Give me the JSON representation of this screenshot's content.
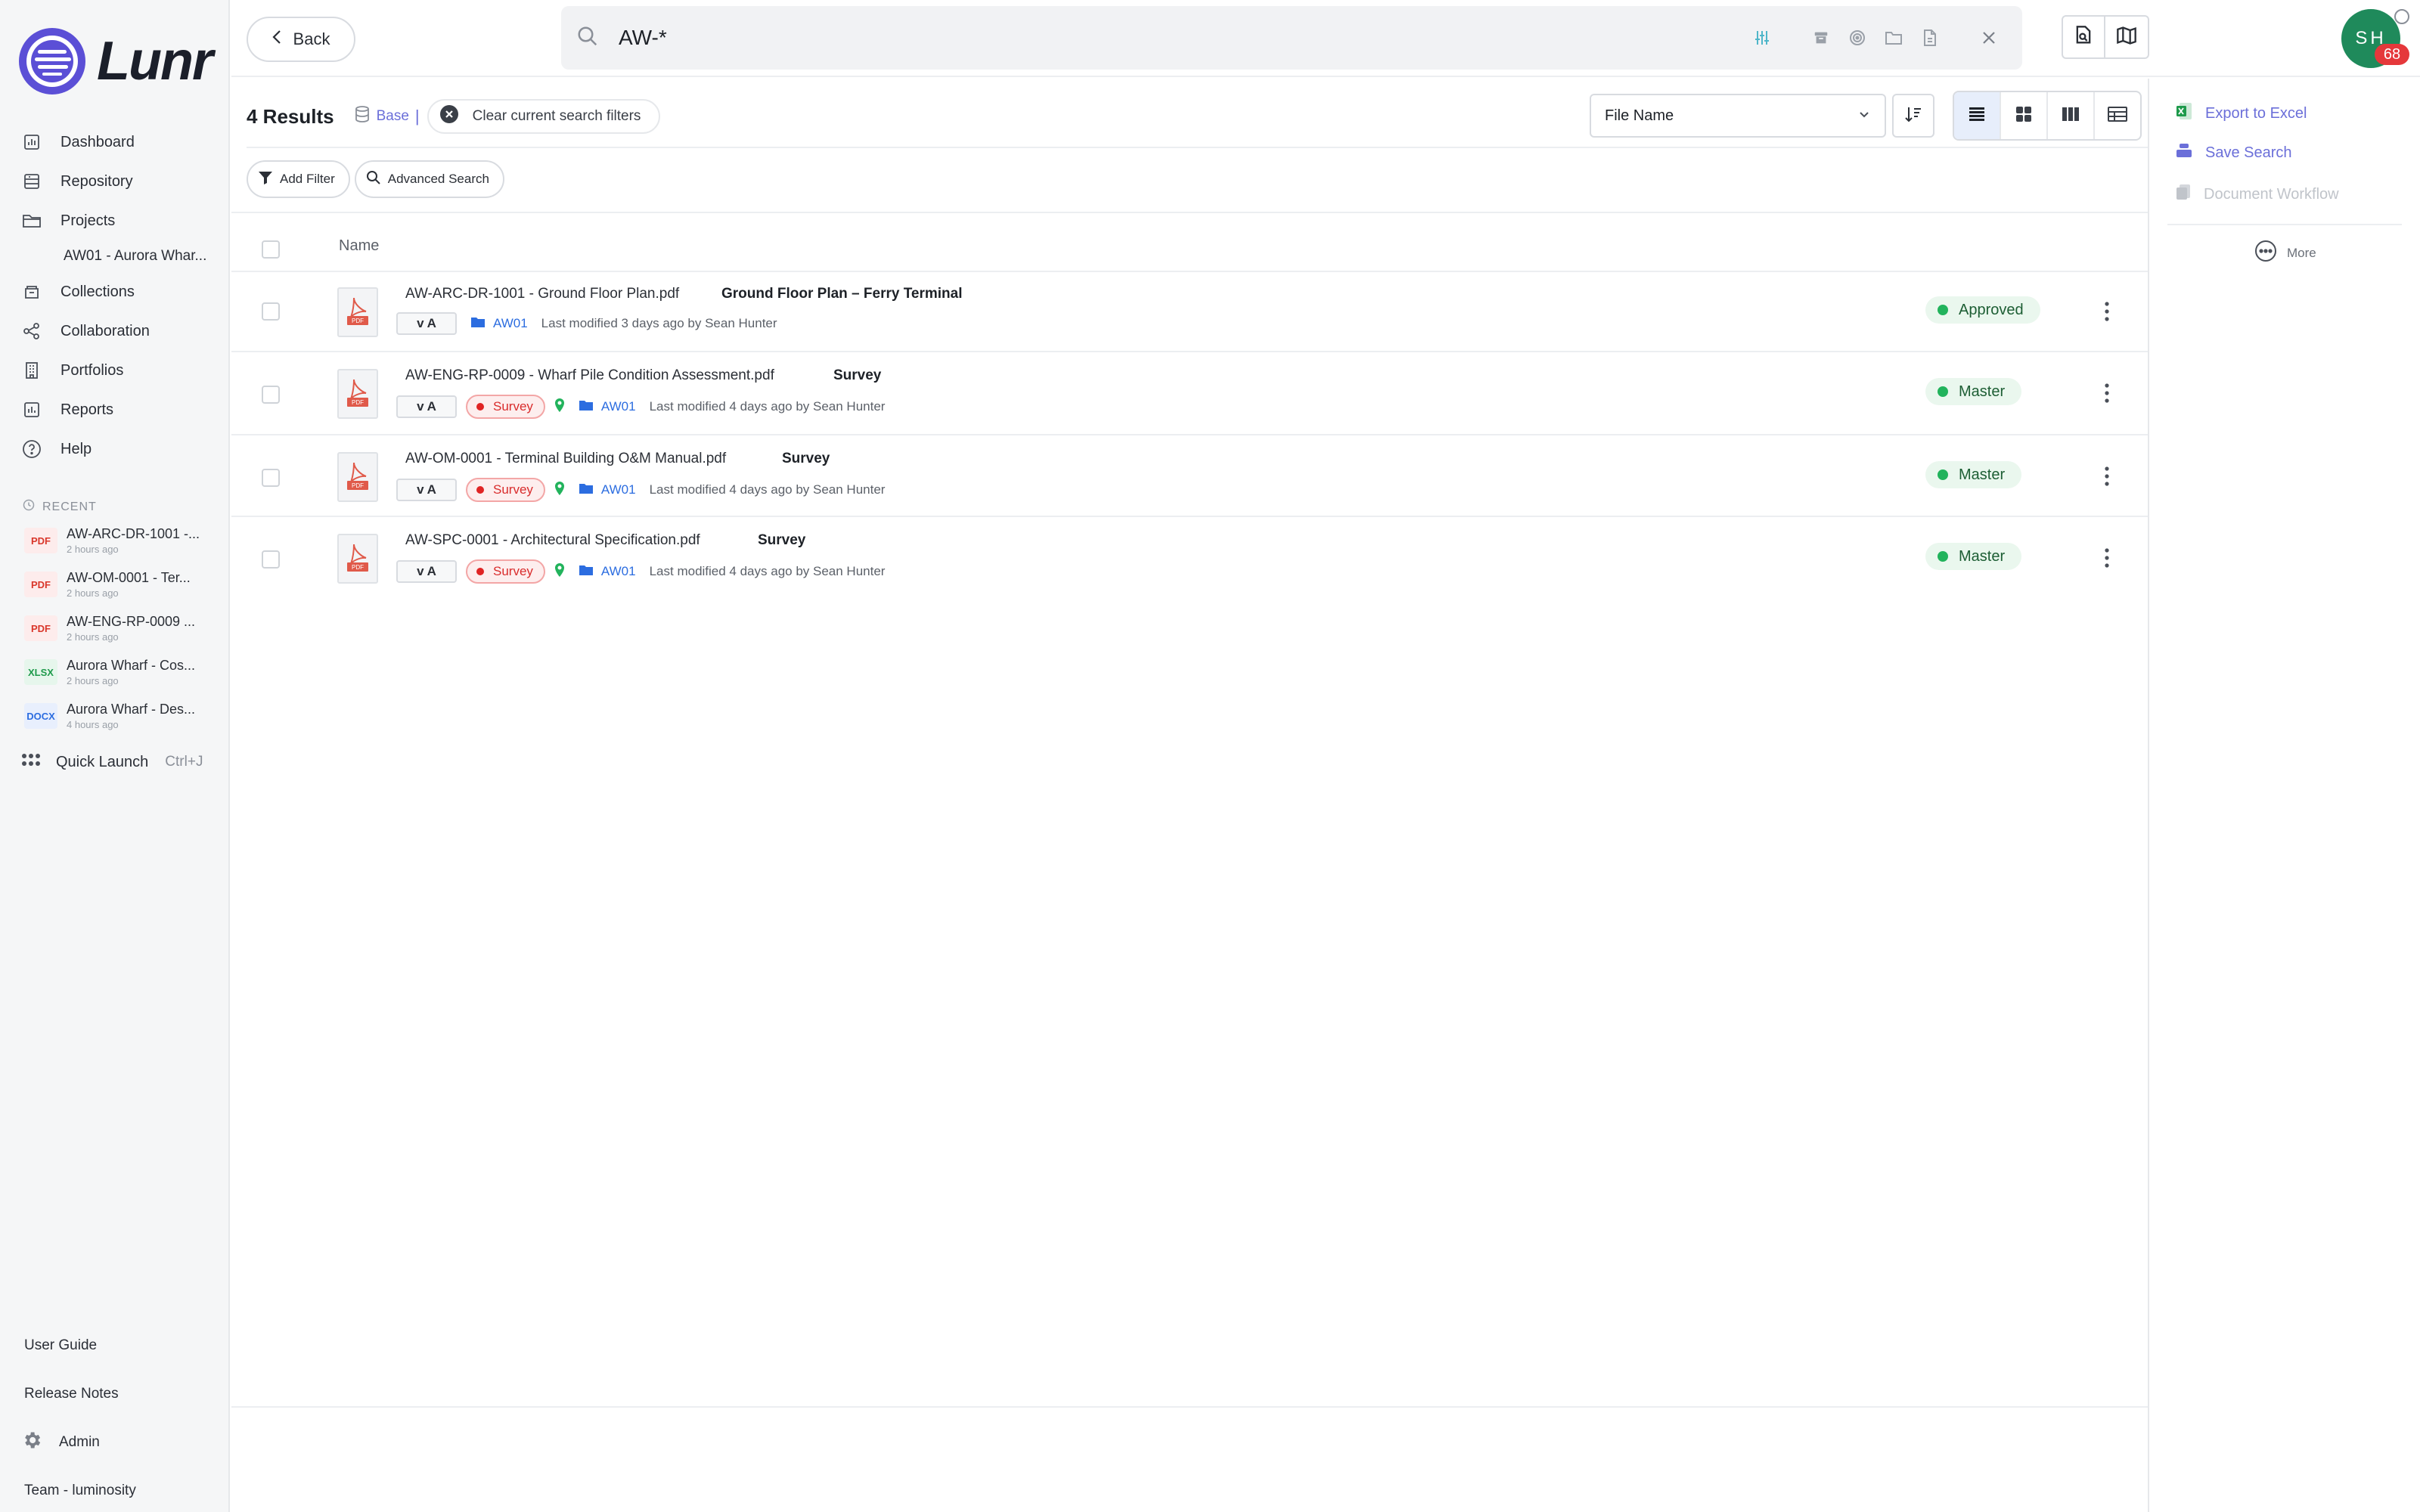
{
  "app": {
    "name": "Lunr"
  },
  "sidebar": {
    "nav": [
      {
        "label": "Dashboard",
        "icon": "dashboard-icon"
      },
      {
        "label": "Repository",
        "icon": "repository-icon"
      },
      {
        "label": "Projects",
        "icon": "folder-icon"
      },
      {
        "label": "AW01 - Aurora Whar...",
        "icon": ""
      },
      {
        "label": "Collections",
        "icon": "collections-icon"
      },
      {
        "label": "Collaboration",
        "icon": "share-icon"
      },
      {
        "label": "Portfolios",
        "icon": "building-icon"
      },
      {
        "label": "Reports",
        "icon": "reports-icon"
      },
      {
        "label": "Help",
        "icon": "help-icon"
      }
    ],
    "recent_heading": "RECENT",
    "recent": [
      {
        "type": "PDF",
        "name": "AW-ARC-DR-1001 -...",
        "time": "2 hours ago"
      },
      {
        "type": "PDF",
        "name": "AW-OM-0001 - Ter...",
        "time": "2 hours ago"
      },
      {
        "type": "PDF",
        "name": "AW-ENG-RP-0009 ...",
        "time": "2 hours ago"
      },
      {
        "type": "XLSX",
        "name": "Aurora Wharf - Cos...",
        "time": "2 hours ago"
      },
      {
        "type": "DOCX",
        "name": "Aurora Wharf - Des...",
        "time": "4 hours ago"
      }
    ],
    "quick_launch": {
      "label": "Quick Launch",
      "shortcut": "Ctrl+J"
    },
    "footer": {
      "user_guide": "User Guide",
      "release_notes": "Release Notes",
      "admin": "Admin",
      "team": "Team - luminosity"
    }
  },
  "topbar": {
    "back_label": "Back",
    "search_value": "AW-*",
    "avatar_initials": "SH",
    "avatar_badge": "68"
  },
  "results": {
    "count_label": "4 Results",
    "base_label": "Base",
    "clear_filters_label": "Clear current search filters",
    "sort_field": "File Name",
    "add_filter_label": "Add Filter",
    "advanced_search_label": "Advanced Search",
    "column_name": "Name",
    "rows": [
      {
        "title": "AW-ARC-DR-1001 - Ground Floor Plan.pdf",
        "desc": "Ground Floor Plan – Ferry Terminal",
        "version": "v A",
        "tag": "",
        "folder": "AW01",
        "modified": "Last modified 3 days ago by Sean Hunter",
        "status": "Approved"
      },
      {
        "title": "AW-ENG-RP-0009 - Wharf Pile Condition Assessment.pdf",
        "desc": "Survey",
        "version": "v A",
        "tag": "Survey",
        "folder": "AW01",
        "modified": "Last modified 4 days ago by Sean Hunter",
        "status": "Master"
      },
      {
        "title": "AW-OM-0001 - Terminal Building O&M Manual.pdf",
        "desc": "Survey",
        "version": "v A",
        "tag": "Survey",
        "folder": "AW01",
        "modified": "Last modified 4 days ago by Sean Hunter",
        "status": "Master"
      },
      {
        "title": "AW-SPC-0001 - Architectural Specification.pdf",
        "desc": "Survey",
        "version": "v A",
        "tag": "Survey",
        "folder": "AW01",
        "modified": "Last modified 4 days ago by Sean Hunter",
        "status": "Master"
      }
    ]
  },
  "right_panel": {
    "export_excel": "Export to Excel",
    "save_search": "Save Search",
    "document_workflow": "Document Workflow",
    "more": "More"
  },
  "colors": {
    "accent": "#6b6fd9",
    "logo": "#5b4fd6",
    "avatar": "#1f8a5b",
    "status_green": "#22b35c",
    "survey_red": "#e02424"
  }
}
